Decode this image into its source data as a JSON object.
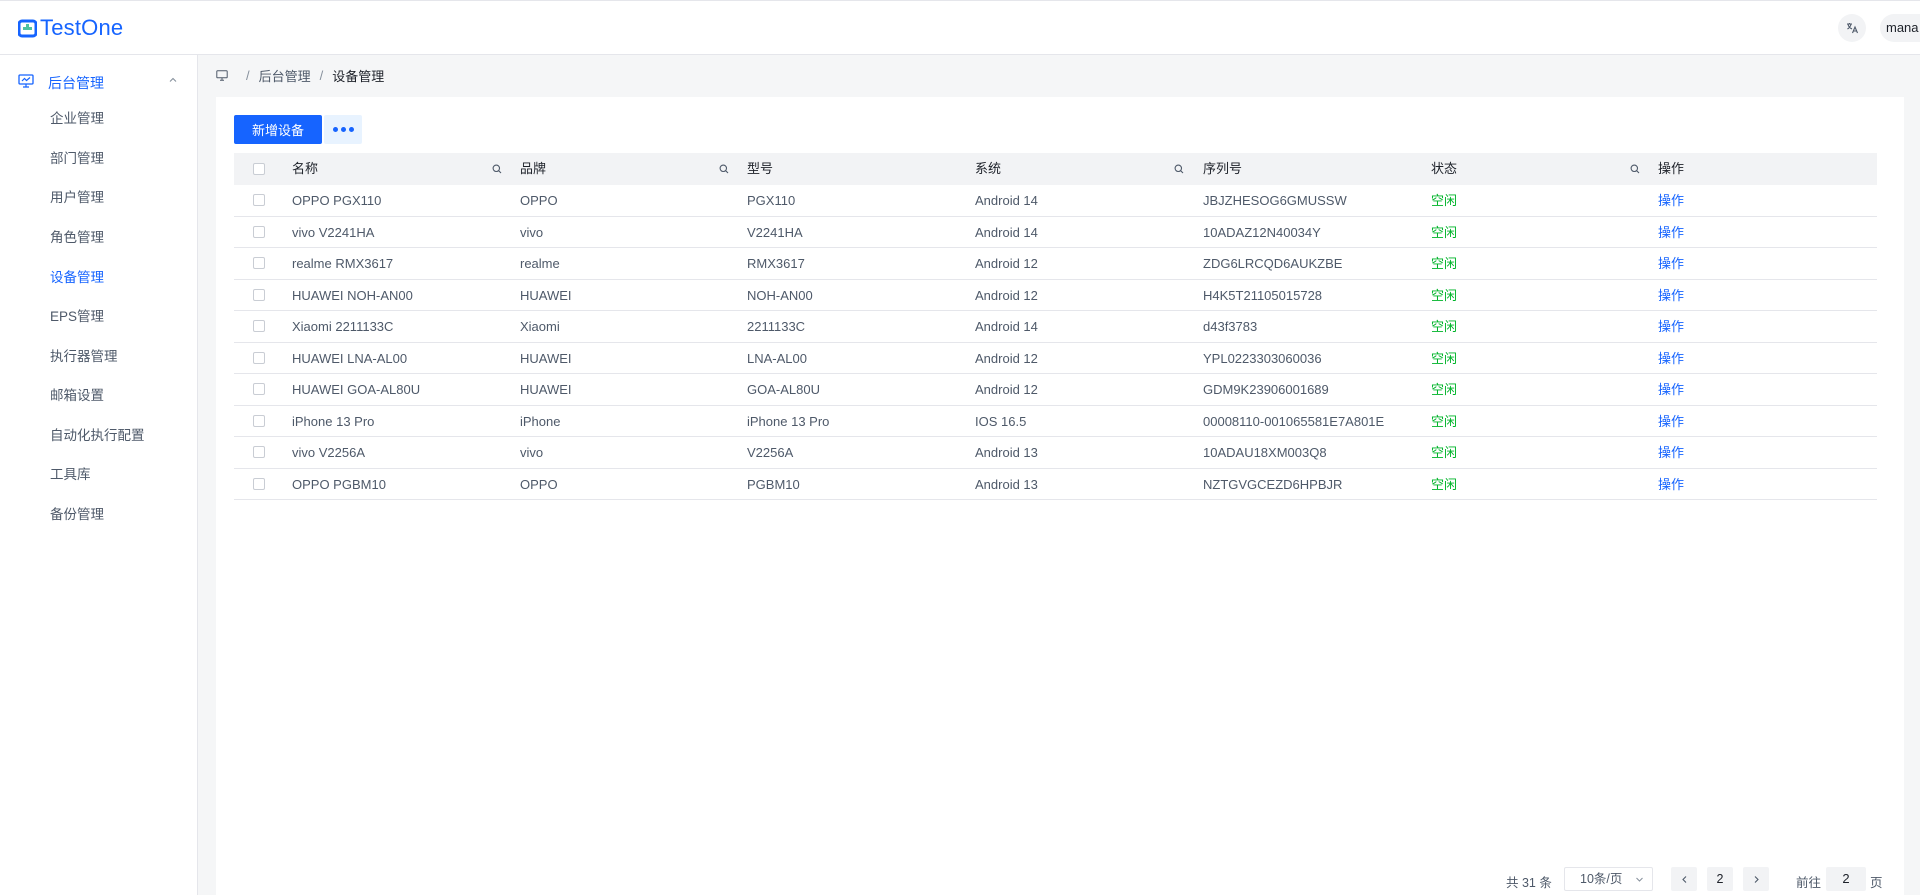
{
  "app": {
    "logo_text": "TestOne",
    "user_name": "mana",
    "translate_icon": "translate-icon"
  },
  "sidebar": {
    "group": {
      "label": "后台管理",
      "icon": "monitor-icon",
      "expanded": true
    },
    "items": [
      {
        "label": "企业管理",
        "active": false
      },
      {
        "label": "部门管理",
        "active": false
      },
      {
        "label": "用户管理",
        "active": false
      },
      {
        "label": "角色管理",
        "active": false
      },
      {
        "label": "设备管理",
        "active": true
      },
      {
        "label": "EPS管理",
        "active": false
      },
      {
        "label": "执行器管理",
        "active": false
      },
      {
        "label": "邮箱设置",
        "active": false
      },
      {
        "label": "自动化执行配置",
        "active": false
      },
      {
        "label": "工具库",
        "active": false
      },
      {
        "label": "备份管理",
        "active": false
      }
    ]
  },
  "breadcrumb": {
    "home_icon": "monitor-icon",
    "items": [
      "后台管理",
      "设备管理"
    ]
  },
  "toolbar": {
    "add_label": "新增设备",
    "more_icon": "more-dots-icon"
  },
  "table": {
    "columns": [
      "名称",
      "品牌",
      "型号",
      "系统",
      "序列号",
      "状态",
      "操作"
    ],
    "rows": [
      {
        "name": "OPPO PGX110",
        "brand": "OPPO",
        "model": "PGX110",
        "system": "Android 14",
        "serial": "JBJZHESOG6GMUSSW",
        "status": "空闲",
        "action": "操作"
      },
      {
        "name": "vivo V2241HA",
        "brand": "vivo",
        "model": "V2241HA",
        "system": "Android 14",
        "serial": "10ADAZ12N40034Y",
        "status": "空闲",
        "action": "操作"
      },
      {
        "name": "realme RMX3617",
        "brand": "realme",
        "model": "RMX3617",
        "system": "Android 12",
        "serial": "ZDG6LRCQD6AUKZBE",
        "status": "空闲",
        "action": "操作"
      },
      {
        "name": "HUAWEI NOH-AN00",
        "brand": "HUAWEI",
        "model": "NOH-AN00",
        "system": "Android 12",
        "serial": "H4K5T21105015728",
        "status": "空闲",
        "action": "操作"
      },
      {
        "name": "Xiaomi 2211133C",
        "brand": "Xiaomi",
        "model": "2211133C",
        "system": "Android 14",
        "serial": "d43f3783",
        "status": "空闲",
        "action": "操作"
      },
      {
        "name": "HUAWEI LNA-AL00",
        "brand": "HUAWEI",
        "model": "LNA-AL00",
        "system": "Android 12",
        "serial": "YPL0223303060036",
        "status": "空闲",
        "action": "操作"
      },
      {
        "name": "HUAWEI GOA-AL80U",
        "brand": "HUAWEI",
        "model": "GOA-AL80U",
        "system": "Android 12",
        "serial": "GDM9K23906001689",
        "status": "空闲",
        "action": "操作"
      },
      {
        "name": "iPhone 13 Pro",
        "brand": "iPhone",
        "model": "iPhone 13 Pro",
        "system": "IOS 16.5",
        "serial": "00008110-001065581E7A801E",
        "status": "空闲",
        "action": "操作"
      },
      {
        "name": "vivo V2256A",
        "brand": "vivo",
        "model": "V2256A",
        "system": "Android 13",
        "serial": "10ADAU18XM003Q8",
        "status": "空闲",
        "action": "操作"
      },
      {
        "name": "OPPO PGBM10",
        "brand": "OPPO",
        "model": "PGBM10",
        "system": "Android 13",
        "serial": "NZTGVGCEZD6HPBJR",
        "status": "空闲",
        "action": "操作"
      }
    ]
  },
  "pagination": {
    "total_text": "共 31 条",
    "page_size": "10条/页",
    "current_page": "2",
    "goto_label": "前往",
    "goto_value": "2",
    "goto_unit": "页"
  },
  "colors": {
    "primary": "#1664ff",
    "status_idle": "#00b42a"
  }
}
